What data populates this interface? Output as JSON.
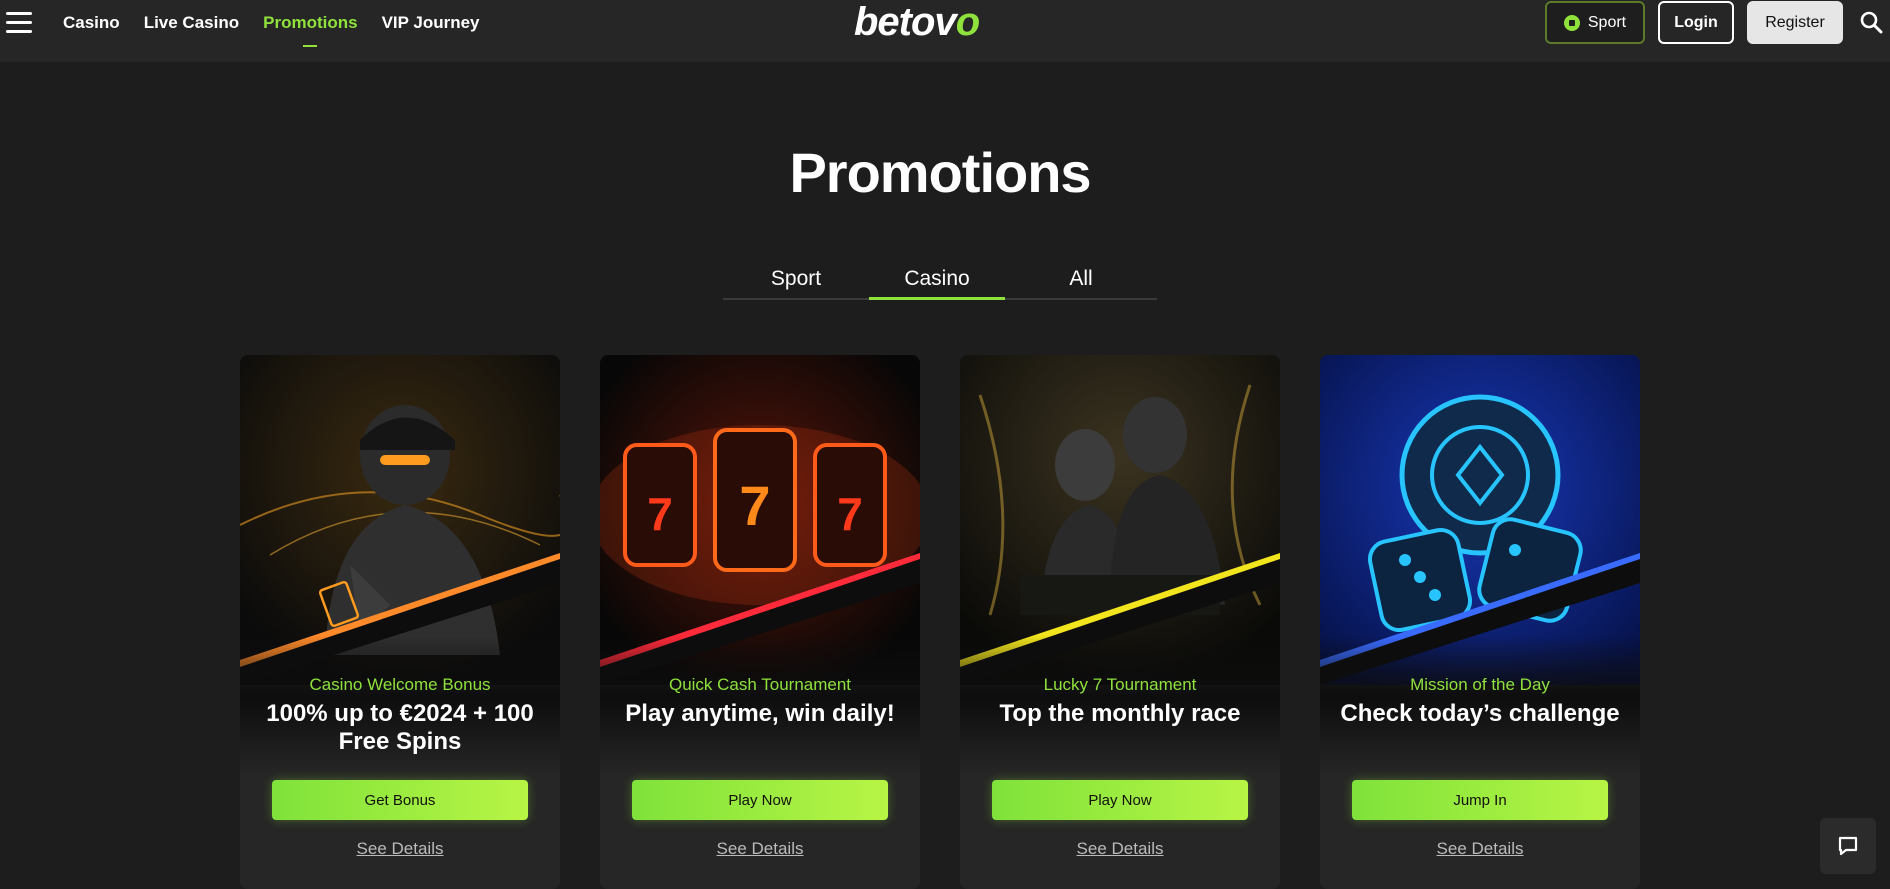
{
  "header": {
    "nav": [
      {
        "label": "Casino"
      },
      {
        "label": "Live Casino"
      },
      {
        "label": "Promotions",
        "active": true
      },
      {
        "label": "VIP Journey"
      }
    ],
    "logo": {
      "text": "betov",
      "dot": "o"
    },
    "sport_button": "Sport",
    "login_button": "Login",
    "register_button": "Register"
  },
  "page": {
    "title": "Promotions",
    "tabs": [
      {
        "label": "Sport"
      },
      {
        "label": "Casino",
        "active": true
      },
      {
        "label": "All"
      }
    ]
  },
  "promotions": [
    {
      "subtitle": "Casino Welcome Bonus",
      "title": "100% up to €2024 + 100 Free Spins",
      "button": "Get Bonus",
      "link": "See Details",
      "accent": "#ff8a2a",
      "art": "poker-player"
    },
    {
      "subtitle": "Quick Cash Tournament",
      "title": "Play anytime, win daily!",
      "button": "Play Now",
      "link": "See Details",
      "accent": "#ff2a3a",
      "art": "slot-reels"
    },
    {
      "subtitle": "Lucky 7 Tournament",
      "title": "Top the monthly race",
      "button": "Play Now",
      "link": "See Details",
      "accent": "#f2e51e",
      "art": "card-table-couple"
    },
    {
      "subtitle": "Mission of the Day",
      "title": "Check today’s challenge",
      "button": "Jump In",
      "link": "See Details",
      "accent": "#3a6bff",
      "art": "chip-and-dice"
    }
  ],
  "colors": {
    "brand_green": "#8fe23c",
    "background": "#1d1d1d",
    "header": "#262626"
  },
  "icons": [
    "menu-icon",
    "soccer-ball-icon",
    "search-icon",
    "chat-icon"
  ]
}
